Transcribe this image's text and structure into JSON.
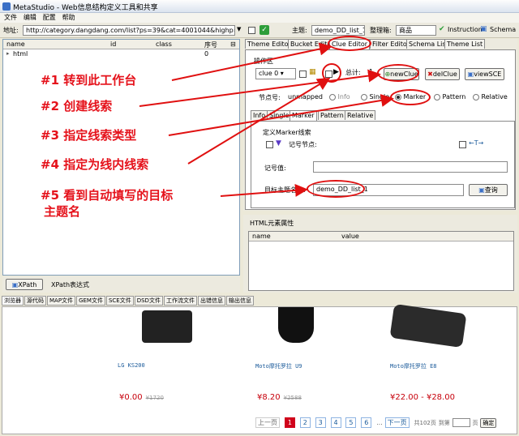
{
  "window": {
    "title": "MetaStudio - Web信息结构定义工具和共享"
  },
  "menu": [
    "文件",
    "编辑",
    "配置",
    "帮助"
  ],
  "toolbar": {
    "address_label": "地址:",
    "address_value": "http://category.dangdang.com/list?ps=39&cat=4001044&highp=&lowp",
    "theme_label": "主题:",
    "theme_value": "demo_DD_list_1",
    "org_label": "整理箱:",
    "org_value": "商品",
    "instruction": "Instruction",
    "schema": "Schema"
  },
  "dom_tree": {
    "columns": [
      "name",
      "id",
      "class",
      "序号"
    ],
    "rows": [
      {
        "name": "html",
        "id": "",
        "class": "",
        "index": "0"
      }
    ]
  },
  "left_bottom": {
    "xpath_button": "XPath",
    "xpath_label": "XPath表达式"
  },
  "editor_tabs": [
    "Theme Editor",
    "Bucket Editor",
    "Clue Editor",
    "Filter Editor",
    "Schema List",
    "Theme List"
  ],
  "clue": {
    "section_label": "操作区",
    "select_value": "clue 0",
    "total_label": "总计:",
    "total_value": "1",
    "new_clue": "newClue",
    "del_clue": "delClue",
    "view_sce": "viewSCE",
    "node_label": "节点号:",
    "node_value": "unmapped",
    "radio_options": [
      "Info",
      "Single",
      "Marker",
      "Pattern",
      "Relative"
    ],
    "selected_radio": "Marker"
  },
  "sub_tabs": [
    "Info",
    "Single",
    "Marker",
    "Pattern",
    "Relative"
  ],
  "marker": {
    "title": "定义Marker线索",
    "record_node": "记号节点:",
    "arrows": "←T→",
    "record_value": "记号值:",
    "theme_name_label": "目标主题名称:",
    "theme_name_value": "demo_DD_list_1",
    "query_btn": "查询"
  },
  "html_attrs": {
    "title": "HTML元素属性",
    "columns": [
      "name",
      "value"
    ]
  },
  "bottom_tabs": [
    "浏览器",
    "源代码",
    "MAP文件",
    "GEM文件",
    "SCE文件",
    "DSD文件",
    "工作流文件",
    "出错信息",
    "输出信息"
  ],
  "products": [
    {
      "name": "LG KS200",
      "price": "¥0.00",
      "old": "¥1720"
    },
    {
      "name": "Moto摩托罗拉 U9",
      "price": "¥8.20",
      "old": "¥2588"
    },
    {
      "name": "Moto摩托罗拉 E8",
      "price": "¥22.00 - ¥28.00",
      "old": ""
    }
  ],
  "pagination": {
    "prev": "上一页",
    "pages": [
      "1",
      "2",
      "3",
      "4",
      "5",
      "6"
    ],
    "current": "1",
    "ellipsis": "...",
    "next": "下一页",
    "total": "共102页",
    "goto": "到第",
    "page_unit": "页",
    "confirm": "确定"
  },
  "annotations": [
    "#1  转到此工作台",
    "#2  创建线索",
    "#3  指定线索类型",
    "#4  指定为线内线索",
    "#5  看到自动填写的目标",
    "主题名"
  ]
}
